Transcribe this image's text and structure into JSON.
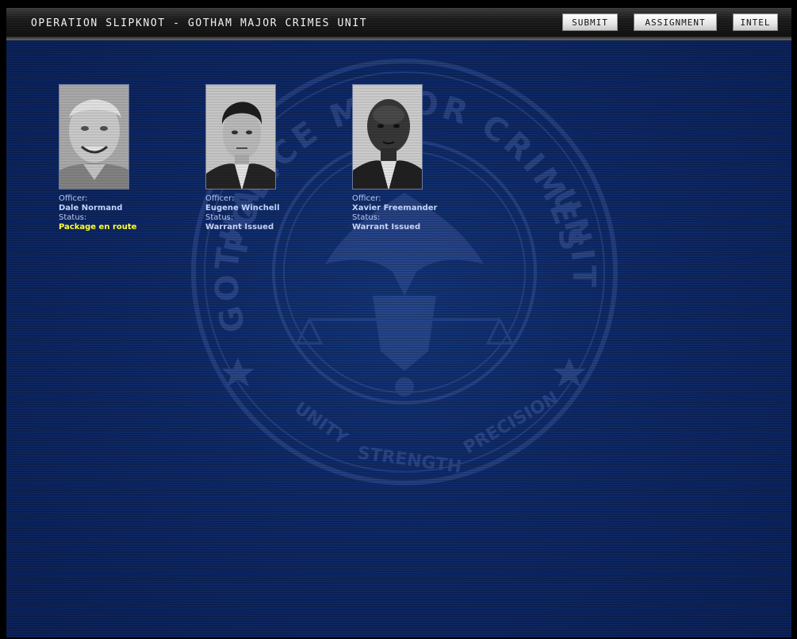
{
  "header": {
    "title": "OPERATION SLIPKNOT - GOTHAM MAJOR CRIMES UNIT",
    "nav": {
      "submit": "SUBMIT",
      "assignment": "ASSIGNMENT",
      "intel": "INTEL"
    }
  },
  "seal": {
    "top_text": "POLICE MAJOR CRIMES",
    "left_text": "GOTHAM",
    "right_text": "UNIT",
    "motto": [
      "UNITY",
      "STRENGTH",
      "PRECISION"
    ]
  },
  "officers": [
    {
      "officer_label": "Officer:",
      "name": "Dale Normand",
      "status_label": "Status:",
      "status": "Package en route"
    },
    {
      "officer_label": "Officer:",
      "name": "Eugene Winchell",
      "status_label": "Status:",
      "status": "Warrant Issued"
    },
    {
      "officer_label": "Officer:",
      "name": "Xavier Freemander",
      "status_label": "Status:",
      "status": "Warrant Issued"
    }
  ],
  "colors": {
    "background": "#0f2a68",
    "label_text": "#b9c8ee",
    "status_alert": "#ffff33"
  }
}
